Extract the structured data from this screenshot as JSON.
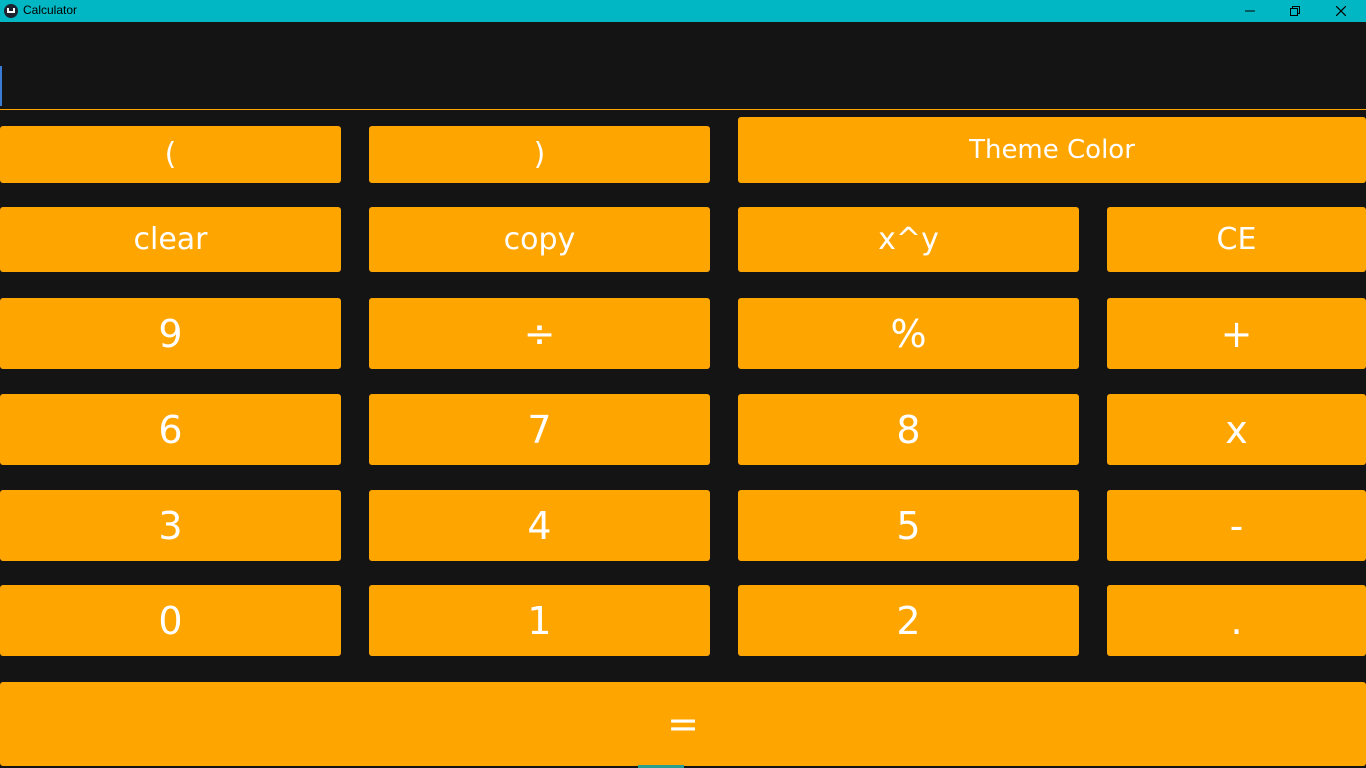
{
  "window": {
    "title": "Calculator",
    "controls": {
      "minimize": "minimize-icon",
      "maximize": "maximize-icon",
      "close": "close-icon"
    }
  },
  "display": {
    "value": "",
    "placeholder": ""
  },
  "keys": {
    "open_paren": "(",
    "close_paren": ")",
    "theme_color": "Theme Color",
    "clear": "clear",
    "copy": "copy",
    "power": "x^y",
    "ce": "CE",
    "nine": "9",
    "divide": "÷",
    "percent": "%",
    "plus": "+",
    "six": "6",
    "seven": "7",
    "eight": "8",
    "multiply": "x",
    "three": "3",
    "four": "4",
    "five": "5",
    "minus": "-",
    "zero": "0",
    "one": "1",
    "two": "2",
    "dot": ".",
    "equals": "="
  },
  "colors": {
    "titlebar": "#00b7c3",
    "background": "#141414",
    "button": "#ffa500",
    "button_text": "#ffffff"
  }
}
